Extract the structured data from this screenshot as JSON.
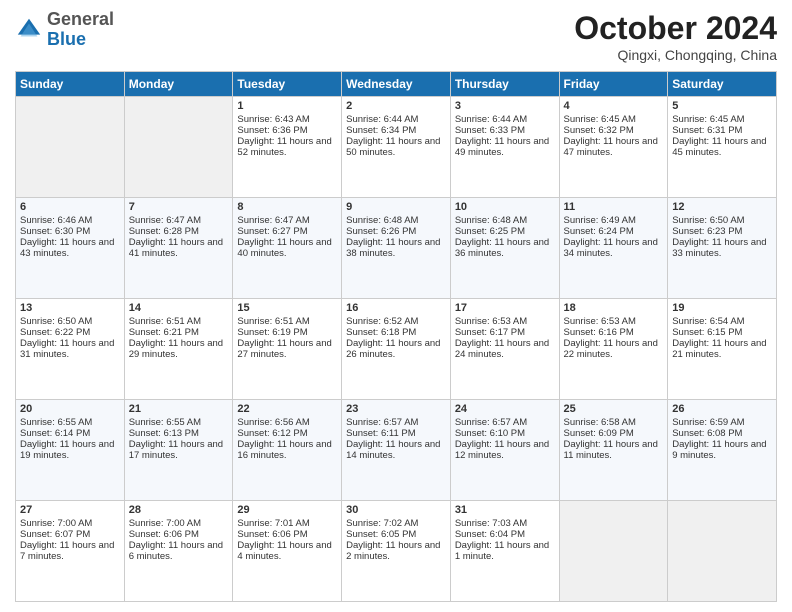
{
  "header": {
    "logo": {
      "general": "General",
      "blue": "Blue"
    },
    "title": "October 2024",
    "subtitle": "Qingxi, Chongqing, China"
  },
  "weekdays": [
    "Sunday",
    "Monday",
    "Tuesday",
    "Wednesday",
    "Thursday",
    "Friday",
    "Saturday"
  ],
  "weeks": [
    [
      {
        "day": "",
        "sunrise": "",
        "sunset": "",
        "daylight": ""
      },
      {
        "day": "",
        "sunrise": "",
        "sunset": "",
        "daylight": ""
      },
      {
        "day": "1",
        "sunrise": "Sunrise: 6:43 AM",
        "sunset": "Sunset: 6:36 PM",
        "daylight": "Daylight: 11 hours and 52 minutes."
      },
      {
        "day": "2",
        "sunrise": "Sunrise: 6:44 AM",
        "sunset": "Sunset: 6:34 PM",
        "daylight": "Daylight: 11 hours and 50 minutes."
      },
      {
        "day": "3",
        "sunrise": "Sunrise: 6:44 AM",
        "sunset": "Sunset: 6:33 PM",
        "daylight": "Daylight: 11 hours and 49 minutes."
      },
      {
        "day": "4",
        "sunrise": "Sunrise: 6:45 AM",
        "sunset": "Sunset: 6:32 PM",
        "daylight": "Daylight: 11 hours and 47 minutes."
      },
      {
        "day": "5",
        "sunrise": "Sunrise: 6:45 AM",
        "sunset": "Sunset: 6:31 PM",
        "daylight": "Daylight: 11 hours and 45 minutes."
      }
    ],
    [
      {
        "day": "6",
        "sunrise": "Sunrise: 6:46 AM",
        "sunset": "Sunset: 6:30 PM",
        "daylight": "Daylight: 11 hours and 43 minutes."
      },
      {
        "day": "7",
        "sunrise": "Sunrise: 6:47 AM",
        "sunset": "Sunset: 6:28 PM",
        "daylight": "Daylight: 11 hours and 41 minutes."
      },
      {
        "day": "8",
        "sunrise": "Sunrise: 6:47 AM",
        "sunset": "Sunset: 6:27 PM",
        "daylight": "Daylight: 11 hours and 40 minutes."
      },
      {
        "day": "9",
        "sunrise": "Sunrise: 6:48 AM",
        "sunset": "Sunset: 6:26 PM",
        "daylight": "Daylight: 11 hours and 38 minutes."
      },
      {
        "day": "10",
        "sunrise": "Sunrise: 6:48 AM",
        "sunset": "Sunset: 6:25 PM",
        "daylight": "Daylight: 11 hours and 36 minutes."
      },
      {
        "day": "11",
        "sunrise": "Sunrise: 6:49 AM",
        "sunset": "Sunset: 6:24 PM",
        "daylight": "Daylight: 11 hours and 34 minutes."
      },
      {
        "day": "12",
        "sunrise": "Sunrise: 6:50 AM",
        "sunset": "Sunset: 6:23 PM",
        "daylight": "Daylight: 11 hours and 33 minutes."
      }
    ],
    [
      {
        "day": "13",
        "sunrise": "Sunrise: 6:50 AM",
        "sunset": "Sunset: 6:22 PM",
        "daylight": "Daylight: 11 hours and 31 minutes."
      },
      {
        "day": "14",
        "sunrise": "Sunrise: 6:51 AM",
        "sunset": "Sunset: 6:21 PM",
        "daylight": "Daylight: 11 hours and 29 minutes."
      },
      {
        "day": "15",
        "sunrise": "Sunrise: 6:51 AM",
        "sunset": "Sunset: 6:19 PM",
        "daylight": "Daylight: 11 hours and 27 minutes."
      },
      {
        "day": "16",
        "sunrise": "Sunrise: 6:52 AM",
        "sunset": "Sunset: 6:18 PM",
        "daylight": "Daylight: 11 hours and 26 minutes."
      },
      {
        "day": "17",
        "sunrise": "Sunrise: 6:53 AM",
        "sunset": "Sunset: 6:17 PM",
        "daylight": "Daylight: 11 hours and 24 minutes."
      },
      {
        "day": "18",
        "sunrise": "Sunrise: 6:53 AM",
        "sunset": "Sunset: 6:16 PM",
        "daylight": "Daylight: 11 hours and 22 minutes."
      },
      {
        "day": "19",
        "sunrise": "Sunrise: 6:54 AM",
        "sunset": "Sunset: 6:15 PM",
        "daylight": "Daylight: 11 hours and 21 minutes."
      }
    ],
    [
      {
        "day": "20",
        "sunrise": "Sunrise: 6:55 AM",
        "sunset": "Sunset: 6:14 PM",
        "daylight": "Daylight: 11 hours and 19 minutes."
      },
      {
        "day": "21",
        "sunrise": "Sunrise: 6:55 AM",
        "sunset": "Sunset: 6:13 PM",
        "daylight": "Daylight: 11 hours and 17 minutes."
      },
      {
        "day": "22",
        "sunrise": "Sunrise: 6:56 AM",
        "sunset": "Sunset: 6:12 PM",
        "daylight": "Daylight: 11 hours and 16 minutes."
      },
      {
        "day": "23",
        "sunrise": "Sunrise: 6:57 AM",
        "sunset": "Sunset: 6:11 PM",
        "daylight": "Daylight: 11 hours and 14 minutes."
      },
      {
        "day": "24",
        "sunrise": "Sunrise: 6:57 AM",
        "sunset": "Sunset: 6:10 PM",
        "daylight": "Daylight: 11 hours and 12 minutes."
      },
      {
        "day": "25",
        "sunrise": "Sunrise: 6:58 AM",
        "sunset": "Sunset: 6:09 PM",
        "daylight": "Daylight: 11 hours and 11 minutes."
      },
      {
        "day": "26",
        "sunrise": "Sunrise: 6:59 AM",
        "sunset": "Sunset: 6:08 PM",
        "daylight": "Daylight: 11 hours and 9 minutes."
      }
    ],
    [
      {
        "day": "27",
        "sunrise": "Sunrise: 7:00 AM",
        "sunset": "Sunset: 6:07 PM",
        "daylight": "Daylight: 11 hours and 7 minutes."
      },
      {
        "day": "28",
        "sunrise": "Sunrise: 7:00 AM",
        "sunset": "Sunset: 6:06 PM",
        "daylight": "Daylight: 11 hours and 6 minutes."
      },
      {
        "day": "29",
        "sunrise": "Sunrise: 7:01 AM",
        "sunset": "Sunset: 6:06 PM",
        "daylight": "Daylight: 11 hours and 4 minutes."
      },
      {
        "day": "30",
        "sunrise": "Sunrise: 7:02 AM",
        "sunset": "Sunset: 6:05 PM",
        "daylight": "Daylight: 11 hours and 2 minutes."
      },
      {
        "day": "31",
        "sunrise": "Sunrise: 7:03 AM",
        "sunset": "Sunset: 6:04 PM",
        "daylight": "Daylight: 11 hours and 1 minute."
      },
      {
        "day": "",
        "sunrise": "",
        "sunset": "",
        "daylight": ""
      },
      {
        "day": "",
        "sunrise": "",
        "sunset": "",
        "daylight": ""
      }
    ]
  ]
}
